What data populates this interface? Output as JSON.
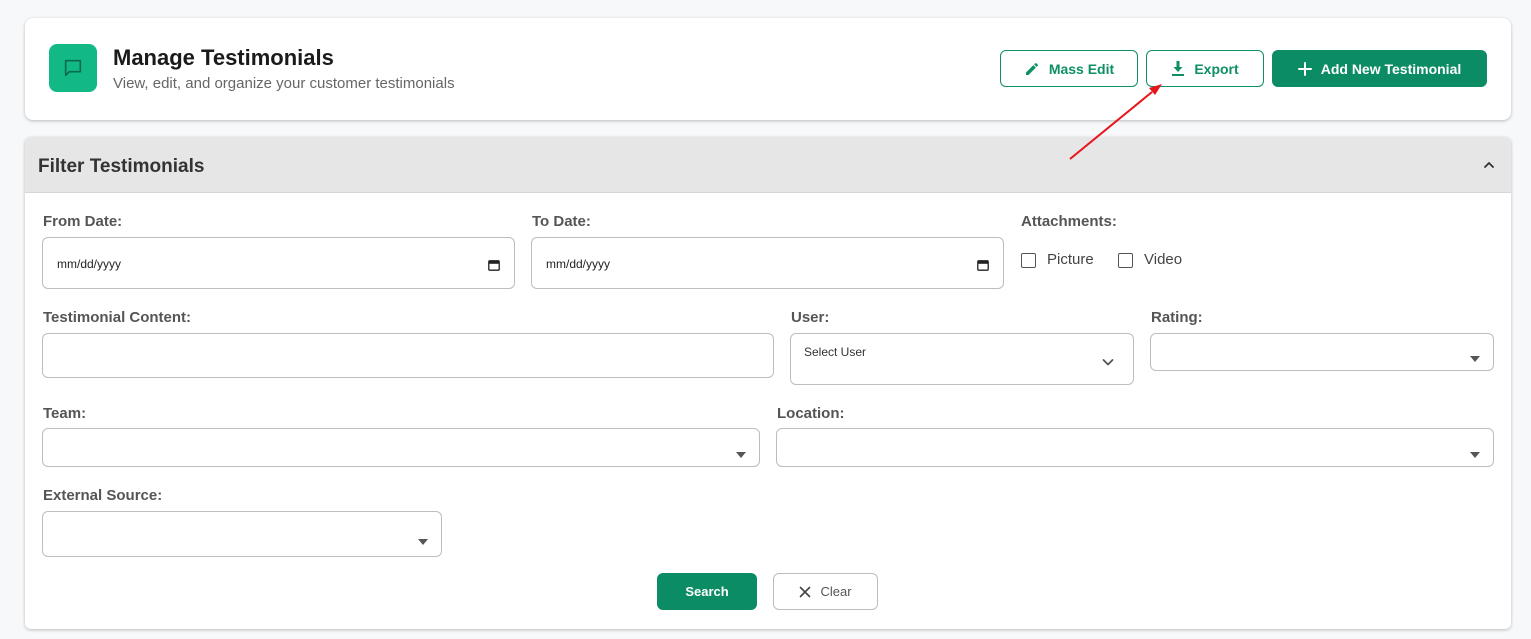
{
  "header": {
    "title": "Manage Testimonials",
    "subtitle": "View, edit, and organize your customer testimonials",
    "logo_icon": "chat-bubble-icon",
    "buttons": {
      "mass_edit": "Mass Edit",
      "export": "Export",
      "add_new": "Add New Testimonial"
    }
  },
  "filter": {
    "title": "Filter Testimonials",
    "from_date_label": "From Date:",
    "from_date_value": "mm/dd/yyyy",
    "to_date_label": "To Date:",
    "to_date_value": "mm/dd/yyyy",
    "attachments_label": "Attachments:",
    "attachment_options": [
      "Picture",
      "Video"
    ],
    "content_label": "Testimonial Content:",
    "user_label": "User:",
    "user_placeholder": "Select User",
    "rating_label": "Rating:",
    "team_label": "Team:",
    "location_label": "Location:",
    "external_source_label": "External Source:",
    "search_button": "Search",
    "clear_button": "Clear"
  },
  "colors": {
    "accent": "#0c8c64",
    "logo_bg": "#12b886",
    "annotation_arrow": "#e8141b"
  }
}
